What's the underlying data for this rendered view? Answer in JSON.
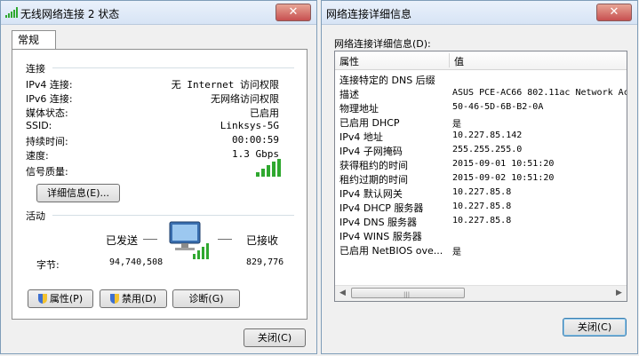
{
  "status_window": {
    "title": "无线网络连接 2 状态",
    "tab": "常规",
    "connection": {
      "heading": "连接",
      "rows": [
        {
          "label": "IPv4 连接:",
          "value": "无 Internet 访问权限"
        },
        {
          "label": "IPv6 连接:",
          "value": "无网络访问权限"
        },
        {
          "label": "媒体状态:",
          "value": "已启用"
        },
        {
          "label": "SSID:",
          "value": "Linksys-5G"
        },
        {
          "label": "持续时间:",
          "value": "00:00:59"
        },
        {
          "label": "速度:",
          "value": "1.3 Gbps"
        }
      ],
      "signal_label": "信号质量:",
      "details_button": "详细信息(E)..."
    },
    "activity": {
      "heading": "活动",
      "sent_label": "已发送",
      "received_label": "已接收",
      "bytes_label": "字节:",
      "bytes_sent": "94,740,508",
      "bytes_received": "829,776"
    },
    "buttons": {
      "properties": "属性(P)",
      "disable": "禁用(D)",
      "diagnose": "诊断(G)",
      "close": "关闭(C)"
    }
  },
  "details_window": {
    "title": "网络连接详细信息",
    "list_label": "网络连接详细信息(D):",
    "columns": {
      "property": "属性",
      "value": "值"
    },
    "rows": [
      {
        "p": "连接特定的 DNS 后缀",
        "v": ""
      },
      {
        "p": "描述",
        "v": "ASUS PCE-AC66 802.11ac Network Ac"
      },
      {
        "p": "物理地址",
        "v": "50-46-5D-6B-B2-0A"
      },
      {
        "p": "已启用 DHCP",
        "v": "是"
      },
      {
        "p": "IPv4 地址",
        "v": "10.227.85.142"
      },
      {
        "p": "IPv4 子网掩码",
        "v": "255.255.255.0"
      },
      {
        "p": "获得租约的时间",
        "v": "2015-09-01 10:51:20"
      },
      {
        "p": "租约过期的时间",
        "v": "2015-09-02 10:51:20"
      },
      {
        "p": "IPv4 默认网关",
        "v": "10.227.85.8"
      },
      {
        "p": "IPv4 DHCP 服务器",
        "v": "10.227.85.8"
      },
      {
        "p": "IPv4 DNS 服务器",
        "v": "10.227.85.8"
      },
      {
        "p": "IPv4 WINS 服务器",
        "v": ""
      },
      {
        "p": "已启用 NetBIOS ove...",
        "v": "是"
      }
    ],
    "close_button": "关闭(C)"
  },
  "icons": {
    "signal": "signal-bars-icon",
    "network": "network-computer-icon",
    "shield": "uac-shield-icon",
    "window_close": "window-close-icon"
  },
  "colors": {
    "signal_green": "#2fa82f",
    "accent_blue": "#3a6fb0",
    "close_red": "#c75050"
  }
}
